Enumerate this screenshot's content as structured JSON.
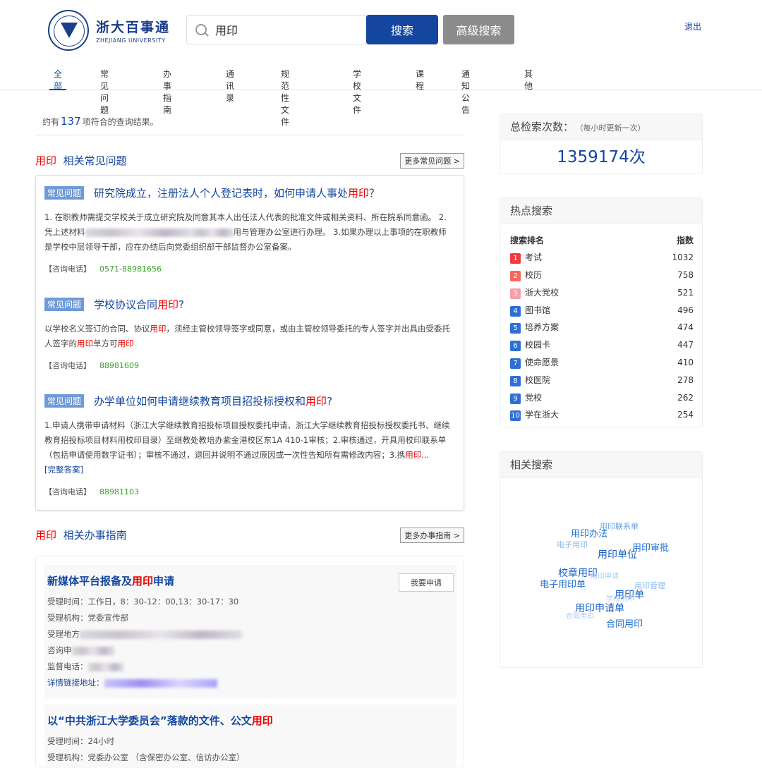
{
  "header": {
    "logo_cn": "浙大百事通",
    "logo_en": "ZHEJIANG UNIVERSITY",
    "search_value": "用印",
    "search_button": "搜索",
    "advanced_button": "高级搜索",
    "logout": "退出"
  },
  "nav": [
    "全部",
    "常见问题",
    "办事指南",
    "通讯录",
    "规范性文件",
    "学校文件",
    "课程",
    "通知公告",
    "其他"
  ],
  "results": {
    "prefix": "约有",
    "count": "137",
    "suffix": "项符合的查询结果。"
  },
  "faq_section": {
    "keyword": "用印",
    "title": "相关常见问题",
    "more": "更多常见问题 >"
  },
  "faqs": [
    {
      "tag": "常见问题",
      "title_a": "研究院成立，注册法人个人登记表时，如何申请人事处",
      "title_hl": "用印",
      "title_b": "？",
      "body_a": "1. 在职教师需提交学校关于成立研究院及同意其本人出任法人代表的批准文件或相关资料、所在院系同意函。 2. 凭上述材料",
      "body_b": "用与管理办公室进行办理。 3.如果办理以上事项的在职教师是学校中层领导干部，应在办结后向党委组织部干部监督办公室备案。",
      "phone_label": "【咨询电话】",
      "phone": "0571-88981656"
    },
    {
      "tag": "常见问题",
      "title_a": "学校协议合同",
      "title_hl": "用印",
      "title_b": "?",
      "body_a": "以学校名义签订的合同、协议",
      "body_hl1": "用印",
      "body_b": "，须经主管校领导签字或同意，或由主管校领导委托的专人签字并出具由受委托人签字的",
      "body_hl2": "用印",
      "body_c": "单方可",
      "body_hl3": "用印",
      "phone_label": "【咨询电话】",
      "phone": "88981609"
    },
    {
      "tag": "常见问题",
      "title_a": "办学单位如何申请继续教育项目招投标授权和",
      "title_hl": "用印",
      "title_b": "?",
      "body_a": "1.申请人携带申请材料（浙江大学继续教育招投标项目授权委托申请、浙江大学继续教育招投标授权委托书、继续教育招投标项目材料用校印目录）至继教处教培办紫金港校区东1A 410-1审核；2.审核通过，开具用校印联系单（包括申请使用数字证书）；审核不通过，退回并说明不通过原因或一次性告知所有需修改内容；3.携",
      "body_hl1": "用印",
      "body_b": "...",
      "link": "[完整答案]",
      "phone_label": "【咨询电话】",
      "phone": "88981103"
    }
  ],
  "guide_section": {
    "keyword": "用印",
    "title": "相关办事指南",
    "more": "更多办事指南 >"
  },
  "guides": [
    {
      "title_a": "新媒体平台报备及",
      "title_hl": "用印",
      "title_b": "申请",
      "apply": "我要申请",
      "time": "受理时间：工作日，8：30-12：00,13：30-17：30",
      "org": "受理机构：党委宣传部",
      "place": "受理地方",
      "consult": "咨询申",
      "supervise": "监督电话：",
      "detail": "详情链接地址："
    },
    {
      "title_a": "以“中共浙江大学委员会”落款的文件、公文",
      "title_hl": "用印",
      "title_b": "",
      "time": "受理时间：24小时",
      "org": "受理机构：党委办公室 （含保密办公室、信访办公室）"
    }
  ],
  "total": {
    "title": "总检索次数：",
    "note": "（每小时更新一次）",
    "value": "1359174次"
  },
  "hot": {
    "title": "热点搜索",
    "col_rank": "搜索排名",
    "col_index": "指数",
    "items": [
      {
        "rank": "1",
        "name": "考试",
        "index": "1032",
        "color": "#f03c3c"
      },
      {
        "rank": "2",
        "name": "校历",
        "index": "758",
        "color": "#f46a5a"
      },
      {
        "rank": "3",
        "name": "浙大党校",
        "index": "521",
        "color": "#f8a0a8"
      },
      {
        "rank": "4",
        "name": "图书馆",
        "index": "496",
        "color": "#2d6fd6"
      },
      {
        "rank": "5",
        "name": "培养方案",
        "index": "474",
        "color": "#2d6fd6"
      },
      {
        "rank": "6",
        "name": "校园卡",
        "index": "447",
        "color": "#2d6fd6"
      },
      {
        "rank": "7",
        "name": "使命愿景",
        "index": "410",
        "color": "#2d6fd6"
      },
      {
        "rank": "8",
        "name": "校医院",
        "index": "278",
        "color": "#2d6fd6"
      },
      {
        "rank": "9",
        "name": "党校",
        "index": "262",
        "color": "#2d6fd6"
      },
      {
        "rank": "10",
        "name": "学在浙大",
        "index": "254",
        "color": "#2d6fd6"
      }
    ]
  },
  "related": {
    "title": "相关搜索",
    "words": [
      "用印联系单",
      "用印办法",
      "电子用印",
      "用印审批",
      "用印单位",
      "校章用印",
      "用印申请",
      "电子用印单",
      "用印管理",
      "用印单",
      "学校用印",
      "用印申请单",
      "合同用印",
      "合同用印"
    ]
  }
}
